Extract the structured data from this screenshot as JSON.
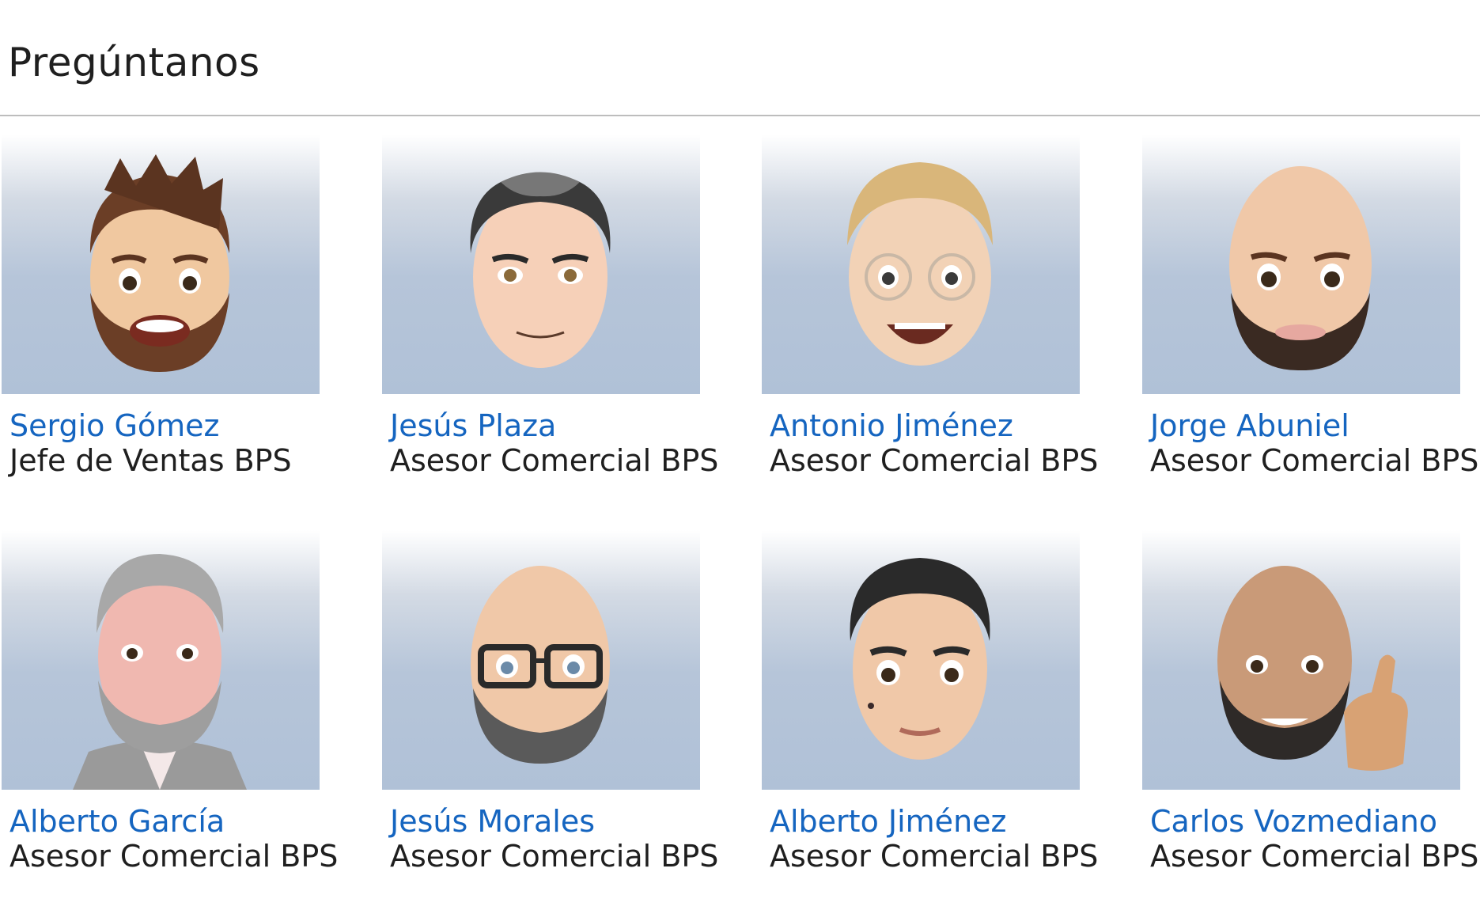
{
  "section": {
    "title": "Pregúntanos"
  },
  "advisors": [
    {
      "name": "Sergio Gómez",
      "role": "Jefe de Ventas BPS",
      "avatar": "bearded-man-brown-hair-avatar"
    },
    {
      "name": "Jesús Plaza",
      "role": "Asesor Comercial BPS",
      "avatar": "man-dark-hair-avatar"
    },
    {
      "name": "Antonio Jiménez",
      "role": "Asesor Comercial BPS",
      "avatar": "blond-man-glasses-avatar"
    },
    {
      "name": "Jorge Abuniel",
      "role": "Asesor Comercial BPS",
      "avatar": "bald-bearded-man-avatar"
    },
    {
      "name": "Alberto García",
      "role": "Asesor Comercial BPS",
      "avatar": "grey-hair-bearded-man-avatar"
    },
    {
      "name": "Jesús Morales",
      "role": "Asesor Comercial BPS",
      "avatar": "bald-man-glasses-avatar"
    },
    {
      "name": "Alberto Jiménez",
      "role": "Asesor Comercial BPS",
      "avatar": "young-man-black-hair-avatar"
    },
    {
      "name": "Carlos Vozmediano",
      "role": "Asesor Comercial BPS",
      "avatar": "bald-bearded-man-thumbs-up-avatar"
    }
  ],
  "colors": {
    "name_link": "#1565c0",
    "text": "#1f1f1f",
    "divider": "#bdbdbd",
    "photo_bg": "#b0c1d7"
  }
}
